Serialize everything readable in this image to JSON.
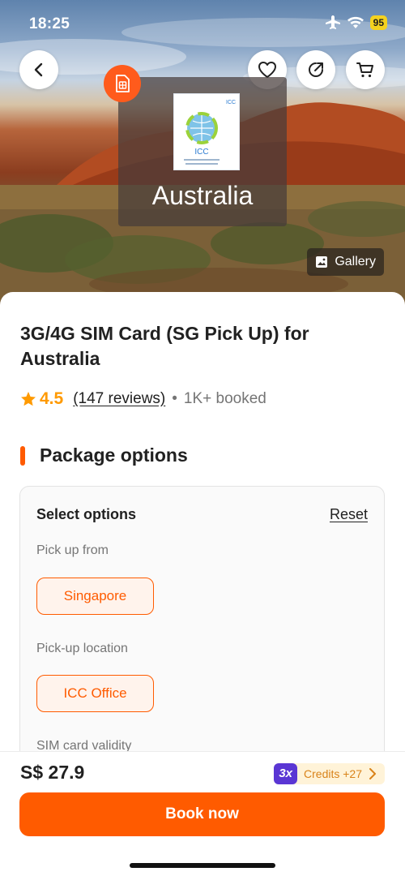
{
  "status_bar": {
    "time": "18:25",
    "battery": "95"
  },
  "hero": {
    "country_label": "Australia",
    "card_brand": "ICC",
    "gallery_label": "Gallery"
  },
  "product": {
    "title": "3G/4G SIM Card (SG Pick Up) for Australia",
    "rating": "4.5",
    "reviews": "(147 reviews)",
    "separator": "•",
    "booked": "1K+ booked"
  },
  "packages": {
    "heading": "Package options",
    "select_title": "Select options",
    "reset_label": "Reset",
    "groups": [
      {
        "label": "Pick up from",
        "selected": "Singapore"
      },
      {
        "label": "Pick-up location",
        "selected": "ICC Office"
      },
      {
        "label": "SIM card validity"
      }
    ]
  },
  "bottom_bar": {
    "price": "S$ 27.9",
    "credits_multiplier": "3x",
    "credits_text": "Credits +27",
    "book_label": "Book now"
  },
  "colors": {
    "accent": "#ff5b00",
    "rating": "#ff9a00",
    "credits_badge": "#5a36d4"
  }
}
